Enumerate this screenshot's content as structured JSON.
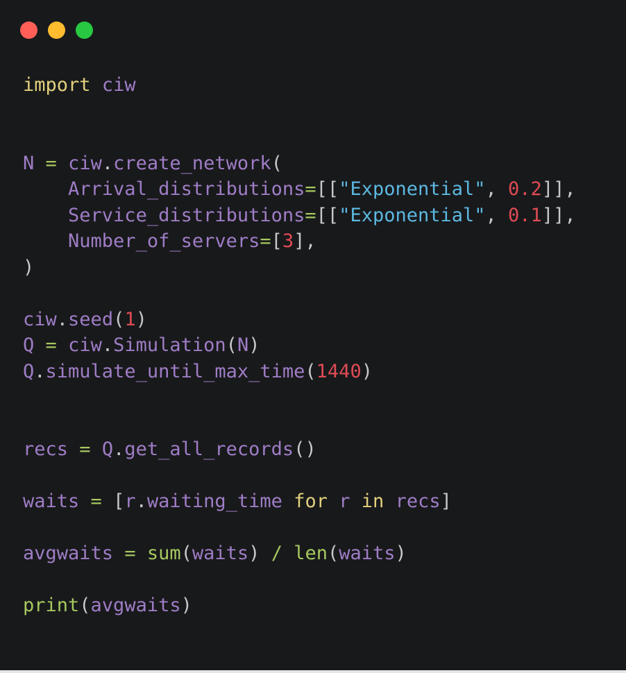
{
  "window": {
    "controls": [
      {
        "name": "close",
        "color": "#ff5f57"
      },
      {
        "name": "minimize",
        "color": "#febc2e"
      },
      {
        "name": "maximize",
        "color": "#28c840"
      }
    ]
  },
  "code": {
    "colors": {
      "background": "#18191b",
      "identifier": "#9f7dc6",
      "keyword": "#e2d07d",
      "function": "#a6c95f",
      "string": "#5cb8e0",
      "number": "#e04b55",
      "punctuation": "#c8c8c8"
    },
    "lines": [
      [
        {
          "t": "import",
          "c": "kw"
        },
        {
          "t": " ",
          "c": "punc"
        },
        {
          "t": "ciw",
          "c": "var"
        }
      ],
      [],
      [],
      [
        {
          "t": "N",
          "c": "var"
        },
        {
          "t": " ",
          "c": "punc"
        },
        {
          "t": "=",
          "c": "op"
        },
        {
          "t": " ",
          "c": "punc"
        },
        {
          "t": "ciw",
          "c": "var"
        },
        {
          "t": ".",
          "c": "punc"
        },
        {
          "t": "create_network",
          "c": "var"
        },
        {
          "t": "(",
          "c": "punc"
        }
      ],
      [
        {
          "t": "    ",
          "c": "punc"
        },
        {
          "t": "Arrival_distributions",
          "c": "var"
        },
        {
          "t": "=",
          "c": "op"
        },
        {
          "t": "[[",
          "c": "punc"
        },
        {
          "t": "\"Exponential\"",
          "c": "str"
        },
        {
          "t": ", ",
          "c": "punc"
        },
        {
          "t": "0.2",
          "c": "num"
        },
        {
          "t": "]],",
          "c": "punc"
        }
      ],
      [
        {
          "t": "    ",
          "c": "punc"
        },
        {
          "t": "Service_distributions",
          "c": "var"
        },
        {
          "t": "=",
          "c": "op"
        },
        {
          "t": "[[",
          "c": "punc"
        },
        {
          "t": "\"Exponential\"",
          "c": "str"
        },
        {
          "t": ", ",
          "c": "punc"
        },
        {
          "t": "0.1",
          "c": "num"
        },
        {
          "t": "]],",
          "c": "punc"
        }
      ],
      [
        {
          "t": "    ",
          "c": "punc"
        },
        {
          "t": "Number_of_servers",
          "c": "var"
        },
        {
          "t": "=",
          "c": "op"
        },
        {
          "t": "[",
          "c": "punc"
        },
        {
          "t": "3",
          "c": "num"
        },
        {
          "t": "],",
          "c": "punc"
        }
      ],
      [
        {
          "t": ")",
          "c": "punc"
        }
      ],
      [],
      [
        {
          "t": "ciw",
          "c": "var"
        },
        {
          "t": ".",
          "c": "punc"
        },
        {
          "t": "seed",
          "c": "var"
        },
        {
          "t": "(",
          "c": "punc"
        },
        {
          "t": "1",
          "c": "num"
        },
        {
          "t": ")",
          "c": "punc"
        }
      ],
      [
        {
          "t": "Q",
          "c": "var"
        },
        {
          "t": " ",
          "c": "punc"
        },
        {
          "t": "=",
          "c": "op"
        },
        {
          "t": " ",
          "c": "punc"
        },
        {
          "t": "ciw",
          "c": "var"
        },
        {
          "t": ".",
          "c": "punc"
        },
        {
          "t": "Simulation",
          "c": "var"
        },
        {
          "t": "(",
          "c": "punc"
        },
        {
          "t": "N",
          "c": "var"
        },
        {
          "t": ")",
          "c": "punc"
        }
      ],
      [
        {
          "t": "Q",
          "c": "var"
        },
        {
          "t": ".",
          "c": "punc"
        },
        {
          "t": "simulate_until_max_time",
          "c": "var"
        },
        {
          "t": "(",
          "c": "punc"
        },
        {
          "t": "1440",
          "c": "num"
        },
        {
          "t": ")",
          "c": "punc"
        }
      ],
      [],
      [],
      [
        {
          "t": "recs",
          "c": "var"
        },
        {
          "t": " ",
          "c": "punc"
        },
        {
          "t": "=",
          "c": "op"
        },
        {
          "t": " ",
          "c": "punc"
        },
        {
          "t": "Q",
          "c": "var"
        },
        {
          "t": ".",
          "c": "punc"
        },
        {
          "t": "get_all_records",
          "c": "var"
        },
        {
          "t": "()",
          "c": "punc"
        }
      ],
      [],
      [
        {
          "t": "waits",
          "c": "var"
        },
        {
          "t": " ",
          "c": "punc"
        },
        {
          "t": "=",
          "c": "op"
        },
        {
          "t": " ",
          "c": "punc"
        },
        {
          "t": "[",
          "c": "punc"
        },
        {
          "t": "r",
          "c": "var"
        },
        {
          "t": ".",
          "c": "punc"
        },
        {
          "t": "waiting_time",
          "c": "var"
        },
        {
          "t": " ",
          "c": "punc"
        },
        {
          "t": "for",
          "c": "kw"
        },
        {
          "t": " ",
          "c": "punc"
        },
        {
          "t": "r",
          "c": "var"
        },
        {
          "t": " ",
          "c": "punc"
        },
        {
          "t": "in",
          "c": "kw"
        },
        {
          "t": " ",
          "c": "punc"
        },
        {
          "t": "recs",
          "c": "var"
        },
        {
          "t": "]",
          "c": "punc"
        }
      ],
      [],
      [
        {
          "t": "avgwaits",
          "c": "var"
        },
        {
          "t": " ",
          "c": "punc"
        },
        {
          "t": "=",
          "c": "op"
        },
        {
          "t": " ",
          "c": "punc"
        },
        {
          "t": "sum",
          "c": "fn"
        },
        {
          "t": "(",
          "c": "punc"
        },
        {
          "t": "waits",
          "c": "var"
        },
        {
          "t": ") ",
          "c": "punc"
        },
        {
          "t": "/",
          "c": "op"
        },
        {
          "t": " ",
          "c": "punc"
        },
        {
          "t": "len",
          "c": "fn"
        },
        {
          "t": "(",
          "c": "punc"
        },
        {
          "t": "waits",
          "c": "var"
        },
        {
          "t": ")",
          "c": "punc"
        }
      ],
      [],
      [
        {
          "t": "print",
          "c": "fn"
        },
        {
          "t": "(",
          "c": "punc"
        },
        {
          "t": "avgwaits",
          "c": "var"
        },
        {
          "t": ")",
          "c": "punc"
        }
      ]
    ]
  }
}
